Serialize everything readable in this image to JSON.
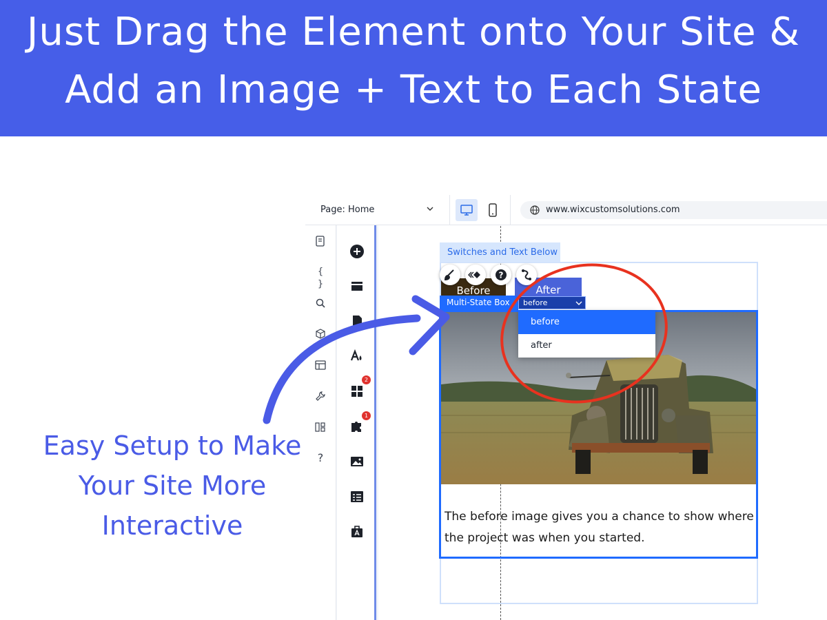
{
  "banner": {
    "line1": "Just Drag the Element onto Your Site &",
    "line2": "Add an Image + Text to Each State",
    "color": "#465ee8"
  },
  "caption": {
    "line1": "Easy Setup to Make",
    "line2": "Your Site More",
    "line3": "Interactive",
    "color": "#4a5be6"
  },
  "editor": {
    "page_selector": "Page: Home",
    "url": "www.wixcustomsolutions.com",
    "left_bar_icons": [
      "pages-icon",
      "code-icon",
      "search-icon",
      "package-icon",
      "table-icon",
      "wrench-icon",
      "apps-icon",
      "help-icon"
    ],
    "add_bar_icons": [
      "add-icon",
      "section-icon",
      "page-icon",
      "theme-icon",
      "apps-grid-icon",
      "puzzle-icon",
      "image-icon",
      "cms-icon",
      "portfolio-icon"
    ],
    "badges": {
      "apps": "2",
      "puzzle": "1"
    }
  },
  "canvas": {
    "section_label": "Switches and Text Below",
    "button_before": "Before",
    "button_after": "After",
    "msb_tag": "Multi-State Box",
    "state_select_value": "before",
    "state_options": [
      "before",
      "after"
    ],
    "body_text_line1": "The before image gives you a chance to show where",
    "body_text_line2": "the project was when you started.",
    "toolbar_icons": [
      "brush-icon",
      "animation-icon",
      "help-circle-icon",
      "connect-icon"
    ],
    "accent": "#1f6bff",
    "highlight_color": "#e8321f"
  }
}
